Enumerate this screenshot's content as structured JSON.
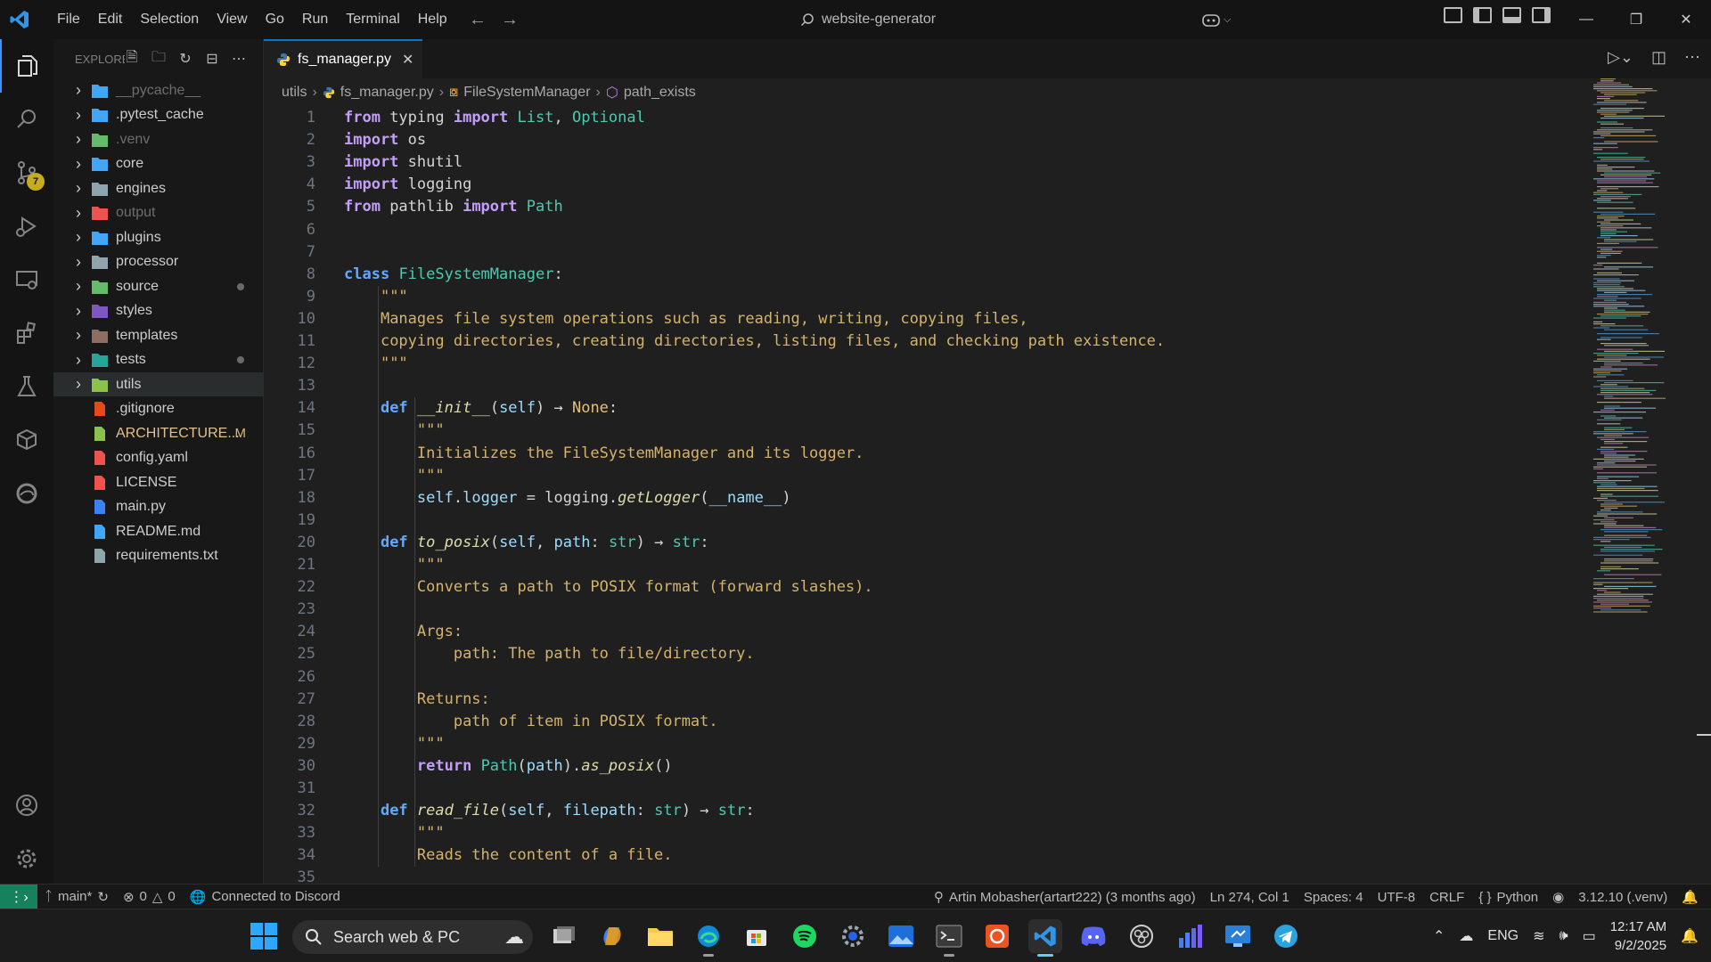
{
  "window": {
    "menu": [
      "File",
      "Edit",
      "Selection",
      "View",
      "Go",
      "Run",
      "Terminal",
      "Help"
    ],
    "search_text": "website-generator"
  },
  "activity": {
    "scm_badge": "7"
  },
  "sidebar": {
    "title": "EXPLORER",
    "items": [
      {
        "label": "__pycache__",
        "kind": "folder",
        "style": "dim",
        "icon_color": "#42a5f5"
      },
      {
        "label": ".pytest_cache",
        "kind": "folder",
        "style": "normal",
        "icon_color": "#42a5f5"
      },
      {
        "label": ".venv",
        "kind": "folder",
        "style": "dim",
        "icon_color": "#66bb6a"
      },
      {
        "label": "core",
        "kind": "folder",
        "style": "normal",
        "icon_color": "#42a5f5"
      },
      {
        "label": "engines",
        "kind": "folder",
        "style": "normal",
        "icon_color": "#90a4ae"
      },
      {
        "label": "output",
        "kind": "folder",
        "style": "dim",
        "icon_color": "#ef5350"
      },
      {
        "label": "plugins",
        "kind": "folder",
        "style": "normal",
        "icon_color": "#42a5f5"
      },
      {
        "label": "processor",
        "kind": "folder",
        "style": "normal",
        "icon_color": "#90a4ae"
      },
      {
        "label": "source",
        "kind": "folder",
        "style": "normal",
        "icon_color": "#66bb6a",
        "dot": true
      },
      {
        "label": "styles",
        "kind": "folder",
        "style": "normal",
        "icon_color": "#7e57c2"
      },
      {
        "label": "templates",
        "kind": "folder",
        "style": "normal",
        "icon_color": "#8d6e63"
      },
      {
        "label": "tests",
        "kind": "folder",
        "style": "normal",
        "icon_color": "#26a69a",
        "dot": true
      },
      {
        "label": "utils",
        "kind": "folder",
        "style": "normal",
        "icon_color": "#8bc34a",
        "selected": true
      },
      {
        "label": ".gitignore",
        "kind": "file",
        "style": "normal",
        "icon_color": "#e64a19"
      },
      {
        "label": "ARCHITECTURE...",
        "kind": "file",
        "style": "modified",
        "icon_color": "#8bc34a",
        "mark": "M"
      },
      {
        "label": "config.yaml",
        "kind": "file",
        "style": "normal",
        "icon_color": "#ef5350"
      },
      {
        "label": "LICENSE",
        "kind": "file",
        "style": "normal",
        "icon_color": "#ef5350"
      },
      {
        "label": "main.py",
        "kind": "file",
        "style": "normal",
        "icon_color": "#3b82f6"
      },
      {
        "label": "README.md",
        "kind": "file",
        "style": "normal",
        "icon_color": "#42a5f5"
      },
      {
        "label": "requirements.txt",
        "kind": "file",
        "style": "normal",
        "icon_color": "#90a4ae"
      }
    ]
  },
  "editor": {
    "tab_label": "fs_manager.py",
    "breadcrumb": [
      "utils",
      "fs_manager.py",
      "FileSystemManager",
      "path_exists"
    ],
    "lines": [
      [
        [
          "kw2",
          "from"
        ],
        [
          "w",
          " typing "
        ],
        [
          "kw2",
          "import"
        ],
        [
          "w",
          " "
        ],
        [
          "cls",
          "List"
        ],
        [
          "w",
          ", "
        ],
        [
          "cls",
          "Optional"
        ]
      ],
      [
        [
          "kw2",
          "import"
        ],
        [
          "w",
          " os"
        ]
      ],
      [
        [
          "kw2",
          "import"
        ],
        [
          "w",
          " shutil"
        ]
      ],
      [
        [
          "kw2",
          "import"
        ],
        [
          "w",
          " logging"
        ]
      ],
      [
        [
          "kw2",
          "from"
        ],
        [
          "w",
          " pathlib "
        ],
        [
          "kw2",
          "import"
        ],
        [
          "w",
          " "
        ],
        [
          "cls",
          "Path"
        ]
      ],
      [],
      [],
      [
        [
          "kw",
          "class"
        ],
        [
          "w",
          " "
        ],
        [
          "cls",
          "FileSystemManager"
        ],
        [
          "w",
          ":"
        ]
      ],
      [
        [
          "w",
          "    "
        ],
        [
          "doc",
          "\"\"\""
        ]
      ],
      [
        [
          "w",
          "    "
        ],
        [
          "doc",
          "Manages file system operations such as reading, writing, copying files,"
        ]
      ],
      [
        [
          "w",
          "    "
        ],
        [
          "doc",
          "copying directories, creating directories, listing files, and checking path existence."
        ]
      ],
      [
        [
          "w",
          "    "
        ],
        [
          "doc",
          "\"\"\""
        ]
      ],
      [],
      [
        [
          "w",
          "    "
        ],
        [
          "kw",
          "def"
        ],
        [
          "w",
          " "
        ],
        [
          "fn_it",
          "__init__"
        ],
        [
          "w",
          "("
        ],
        [
          "self",
          "self"
        ],
        [
          "w",
          ") → "
        ],
        [
          "yellow",
          "None"
        ],
        [
          "w",
          ":"
        ]
      ],
      [
        [
          "w",
          "        "
        ],
        [
          "doc",
          "\"\"\""
        ]
      ],
      [
        [
          "w",
          "        "
        ],
        [
          "doc",
          "Initializes the FileSystemManager and its logger."
        ]
      ],
      [
        [
          "w",
          "        "
        ],
        [
          "doc",
          "\"\"\""
        ]
      ],
      [
        [
          "w",
          "        "
        ],
        [
          "self",
          "self"
        ],
        [
          "w",
          "."
        ],
        [
          "self",
          "logger"
        ],
        [
          "w",
          " = logging."
        ],
        [
          "fn_it",
          "getLogger"
        ],
        [
          "w",
          "("
        ],
        [
          "self",
          "__name__"
        ],
        [
          "w",
          ")"
        ]
      ],
      [],
      [
        [
          "w",
          "    "
        ],
        [
          "kw",
          "def"
        ],
        [
          "w",
          " "
        ],
        [
          "fn_it",
          "to_posix"
        ],
        [
          "w",
          "("
        ],
        [
          "self",
          "self"
        ],
        [
          "w",
          ", "
        ],
        [
          "self",
          "path"
        ],
        [
          "w",
          ": "
        ],
        [
          "cls",
          "str"
        ],
        [
          "w",
          ") → "
        ],
        [
          "cls",
          "str"
        ],
        [
          "w",
          ":"
        ]
      ],
      [
        [
          "w",
          "        "
        ],
        [
          "doc",
          "\"\"\""
        ]
      ],
      [
        [
          "w",
          "        "
        ],
        [
          "doc",
          "Converts a path to POSIX format (forward slashes)."
        ]
      ],
      [],
      [
        [
          "w",
          "        "
        ],
        [
          "doc",
          "Args:"
        ]
      ],
      [
        [
          "w",
          "            "
        ],
        [
          "doc",
          "path: The path to file/directory."
        ]
      ],
      [],
      [
        [
          "w",
          "        "
        ],
        [
          "doc",
          "Returns:"
        ]
      ],
      [
        [
          "w",
          "            "
        ],
        [
          "doc",
          "path of item in POSIX format."
        ]
      ],
      [
        [
          "w",
          "        "
        ],
        [
          "doc",
          "\"\"\""
        ]
      ],
      [
        [
          "w",
          "        "
        ],
        [
          "kw2",
          "return"
        ],
        [
          "w",
          " "
        ],
        [
          "cls",
          "Path"
        ],
        [
          "w",
          "("
        ],
        [
          "self",
          "path"
        ],
        [
          "w",
          ")."
        ],
        [
          "fn_it",
          "as_posix"
        ],
        [
          "w",
          "()"
        ]
      ],
      [],
      [
        [
          "w",
          "    "
        ],
        [
          "kw",
          "def"
        ],
        [
          "w",
          " "
        ],
        [
          "fn_it",
          "read_file"
        ],
        [
          "w",
          "("
        ],
        [
          "self",
          "self"
        ],
        [
          "w",
          ", "
        ],
        [
          "self",
          "filepath"
        ],
        [
          "w",
          ": "
        ],
        [
          "cls",
          "str"
        ],
        [
          "w",
          ") → "
        ],
        [
          "cls",
          "str"
        ],
        [
          "w",
          ":"
        ]
      ],
      [
        [
          "w",
          "        "
        ],
        [
          "doc",
          "\"\"\""
        ]
      ],
      [
        [
          "w",
          "        "
        ],
        [
          "doc",
          "Reads the content of a file."
        ]
      ],
      []
    ]
  },
  "status": {
    "branch": "main*",
    "errors": "0",
    "warnings": "0",
    "discord": "Connected to Discord",
    "blame": "Artin Mobasher(artart222) (3 months ago)",
    "position": "Ln 274, Col 1",
    "spaces": "Spaces: 4",
    "encoding": "UTF-8",
    "eol": "CRLF",
    "language": "Python",
    "interpreter": "3.12.10 (.venv)"
  },
  "taskbar": {
    "search_label": "Search web & PC",
    "lang": "ENG",
    "time": "12:17 AM",
    "date": "9/2/2025"
  }
}
